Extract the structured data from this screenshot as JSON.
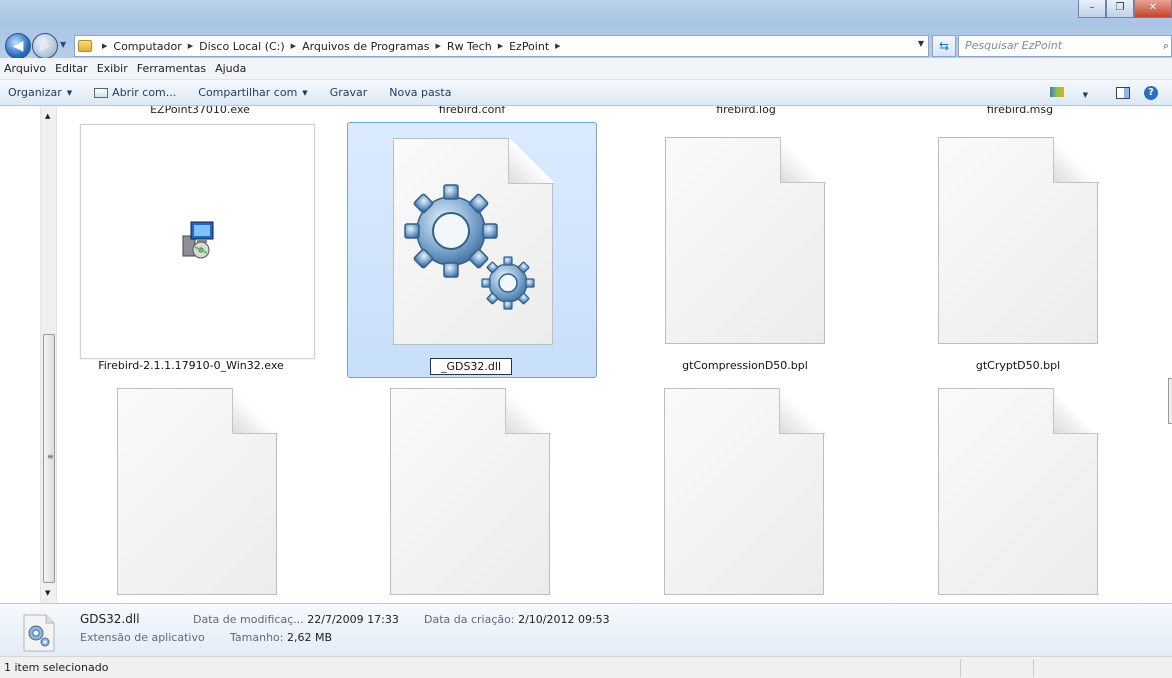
{
  "address": {
    "crumbs": [
      "Computador",
      "Disco Local (C:)",
      "Arquivos de Programas",
      "Rw Tech",
      "EzPoint"
    ]
  },
  "search": {
    "placeholder": "Pesquisar EzPoint"
  },
  "menu": {
    "items": [
      "Arquivo",
      "Editar",
      "Exibir",
      "Ferramentas",
      "Ajuda"
    ]
  },
  "toolbar": {
    "organize": "Organizar",
    "open_with": "Abrir com...",
    "share": "Compartilhar com",
    "burn": "Gravar",
    "new_folder": "Nova pasta"
  },
  "top_labels": [
    "EZPoint37010.exe",
    "firebird.conf",
    "firebird.log",
    "firebird.msg"
  ],
  "files": [
    {
      "name": "Firebird-2.1.1.17910-0_Win32.exe",
      "icon": "installer-icon"
    },
    {
      "name": "_GDS32.dll",
      "icon": "dll-gears-icon",
      "selected": true
    },
    {
      "name": "gtCompressionD50.bpl",
      "icon": "blank-file-icon"
    },
    {
      "name": "gtCryptD50.bpl",
      "icon": "blank-file-icon"
    },
    {
      "name": "",
      "icon": "blank-file-icon"
    },
    {
      "name": "",
      "icon": "blank-file-icon"
    },
    {
      "name": "",
      "icon": "blank-file-icon"
    },
    {
      "name": "",
      "icon": "blank-file-icon"
    }
  ],
  "details": {
    "name": "GDS32.dll",
    "type": "Extensão de aplicativo",
    "modified_label": "Data de modificaç...",
    "modified_value": "22/7/2009 17:33",
    "size_label": "Tamanho:",
    "size_value": "2,62 MB",
    "created_label": "Data da criação:",
    "created_value": "2/10/2012 09:53"
  },
  "status": {
    "text": "1 item selecionado"
  }
}
